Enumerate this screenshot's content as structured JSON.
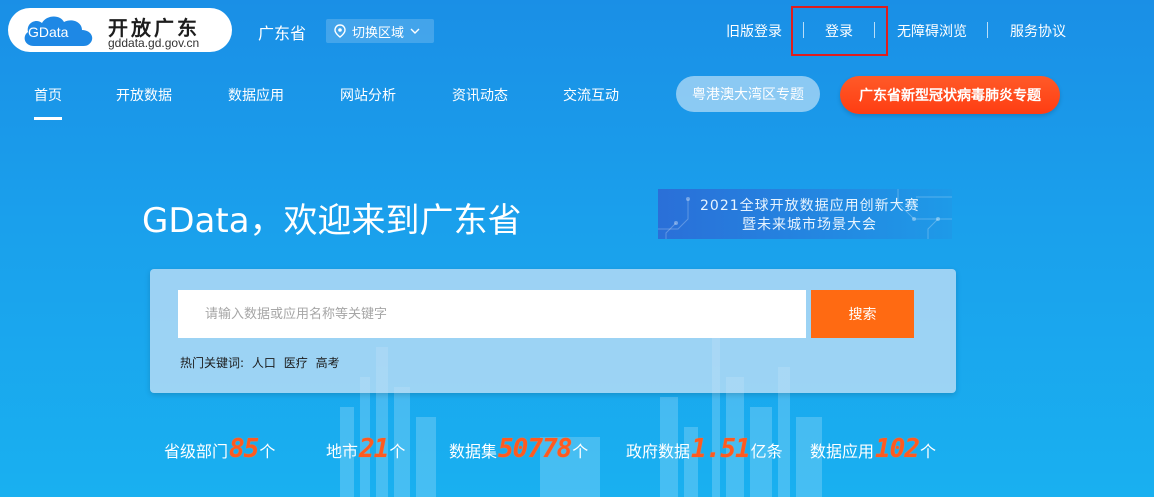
{
  "header": {
    "logo_mark": "GData",
    "logo_title": "开放广东",
    "logo_domain": "gddata.gd.gov.cn",
    "province": "广东省",
    "region_switch_label": "切换区域",
    "links": {
      "old_login": "旧版登录",
      "login": "登录",
      "accessible": "无障碍浏览",
      "service": "服务协议"
    }
  },
  "nav": {
    "items": [
      "首页",
      "开放数据",
      "数据应用",
      "网站分析",
      "资讯动态",
      "交流互动"
    ],
    "active_index": 0,
    "gba_topic": "粤港澳大湾区专题",
    "covid_topic": "广东省新型冠状病毒肺炎专题"
  },
  "hero": {
    "welcome": "GData，欢迎来到广东省",
    "banner_line1": "2021全球开放数据应用创新大赛",
    "banner_line2": "暨未来城市场景大会"
  },
  "search": {
    "placeholder": "请输入数据或应用名称等关键字",
    "value": "",
    "button": "搜索",
    "hot_label": "热门关键词:",
    "hot_keywords": [
      "人口",
      "医疗",
      "高考"
    ]
  },
  "stats": [
    {
      "label": "省级部门",
      "value": "85",
      "unit": "个"
    },
    {
      "label": "地市",
      "value": "21",
      "unit": "个"
    },
    {
      "label": "数据集",
      "value": "50778",
      "unit": "个"
    },
    {
      "label": "政府数据",
      "value": "1.51",
      "unit": "亿条"
    },
    {
      "label": "数据应用",
      "value": "102",
      "unit": "个"
    }
  ],
  "colors": {
    "accent_orange": "#ff6a12",
    "highlight_red": "#e11d1d",
    "stat_number": "#ff5a1f"
  }
}
